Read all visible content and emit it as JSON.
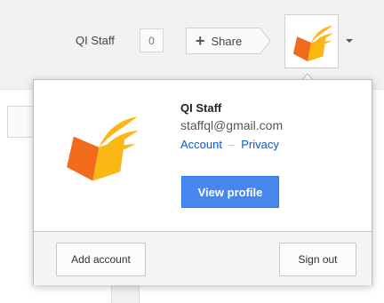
{
  "header": {
    "user_name": "QI Staff",
    "notification_count": "0",
    "share_label": "Share",
    "share_icon_glyph": "+"
  },
  "profile_card": {
    "name": "QI Staff",
    "email": "staffql@gmail.com",
    "account_link": "Account",
    "separator": "–",
    "privacy_link": "Privacy",
    "view_profile_button": "View profile",
    "add_account_button": "Add account",
    "sign_out_button": "Sign out"
  },
  "icons": {
    "avatar": "winged-book-logo-icon",
    "account_menu_caret": "caret-down-icon"
  },
  "colors": {
    "primary_button": "#4787ed",
    "link": "#1155cc",
    "logo_orange": "#f26a1b",
    "logo_yellow": "#fbb714"
  }
}
